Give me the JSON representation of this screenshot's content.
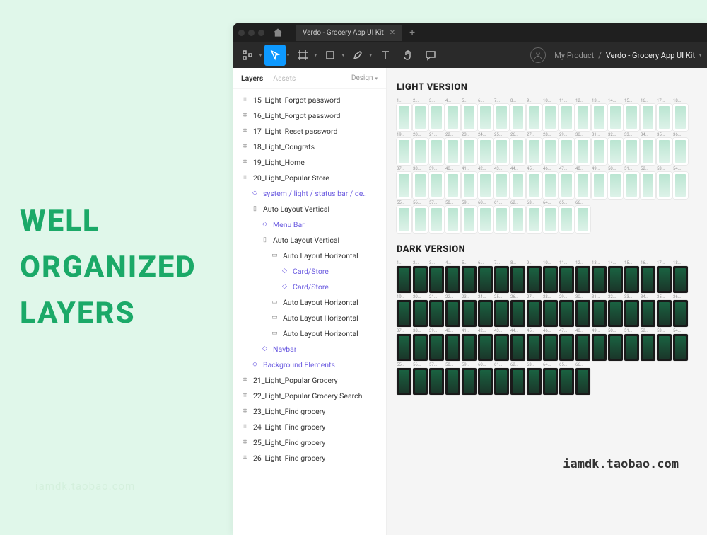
{
  "hero_line1": "WELL",
  "hero_line2": "ORGANIZED",
  "hero_line3": "LAYERS",
  "watermark": "iamdk.taobao.com",
  "watermark2": "iamdk.taobao.com",
  "tab_title": "Verdo - Grocery App UI Kit",
  "breadcrumb_parent": "My Product",
  "breadcrumb_current": "Verdo - Grocery App UI Kit",
  "panel_tab_layers": "Layers",
  "panel_tab_assets": "Assets",
  "panel_design": "Design",
  "section_light": "LIGHT VERSION",
  "section_dark": "DARK VERSION",
  "layers": [
    {
      "name": "15_Light_Forgot password",
      "ic": "frame",
      "ind": 0
    },
    {
      "name": "16_Light_Forgot password",
      "ic": "frame",
      "ind": 0
    },
    {
      "name": "17_Light_Reset password",
      "ic": "frame",
      "ind": 0
    },
    {
      "name": "18_Light_Congrats",
      "ic": "frame",
      "ind": 0
    },
    {
      "name": "19_Light_Home",
      "ic": "frame",
      "ind": 0
    },
    {
      "name": "20_Light_Popular Store",
      "ic": "frame",
      "ind": 0
    },
    {
      "name": "system / light / status bar / de..",
      "ic": "diamond",
      "ind": 1,
      "cmp": true
    },
    {
      "name": "Auto Layout Vertical",
      "ic": "vert",
      "ind": 1
    },
    {
      "name": "Menu Bar",
      "ic": "diamond",
      "ind": 2,
      "cmp": true
    },
    {
      "name": "Auto Layout Vertical",
      "ic": "vert",
      "ind": 2
    },
    {
      "name": "Auto Layout Horizontal",
      "ic": "horiz",
      "ind": 3
    },
    {
      "name": "Card/Store",
      "ic": "diamond",
      "ind": 4,
      "cmp": true
    },
    {
      "name": "Card/Store",
      "ic": "diamond",
      "ind": 4,
      "cmp": true
    },
    {
      "name": "Auto Layout Horizontal",
      "ic": "horiz",
      "ind": 3
    },
    {
      "name": "Auto Layout Horizontal",
      "ic": "horiz",
      "ind": 3
    },
    {
      "name": "Auto Layout Horizontal",
      "ic": "horiz",
      "ind": 3
    },
    {
      "name": "Navbar",
      "ic": "diamond",
      "ind": 2,
      "cmp": true
    },
    {
      "name": "Background Elements",
      "ic": "diamond",
      "ind": 1,
      "cmp": true
    },
    {
      "name": "21_Light_Popular Grocery",
      "ic": "frame",
      "ind": 0
    },
    {
      "name": "22_Light_Popular Grocery Search",
      "ic": "frame",
      "ind": 0
    },
    {
      "name": "23_Light_Find grocery",
      "ic": "frame",
      "ind": 0
    },
    {
      "name": "24_Light_Find grocery",
      "ic": "frame",
      "ind": 0
    },
    {
      "name": "25_Light_Find grocery",
      "ic": "frame",
      "ind": 0
    },
    {
      "name": "26_Light_Find grocery",
      "ic": "frame",
      "ind": 0
    }
  ],
  "light_count": 66,
  "dark_count": 66
}
